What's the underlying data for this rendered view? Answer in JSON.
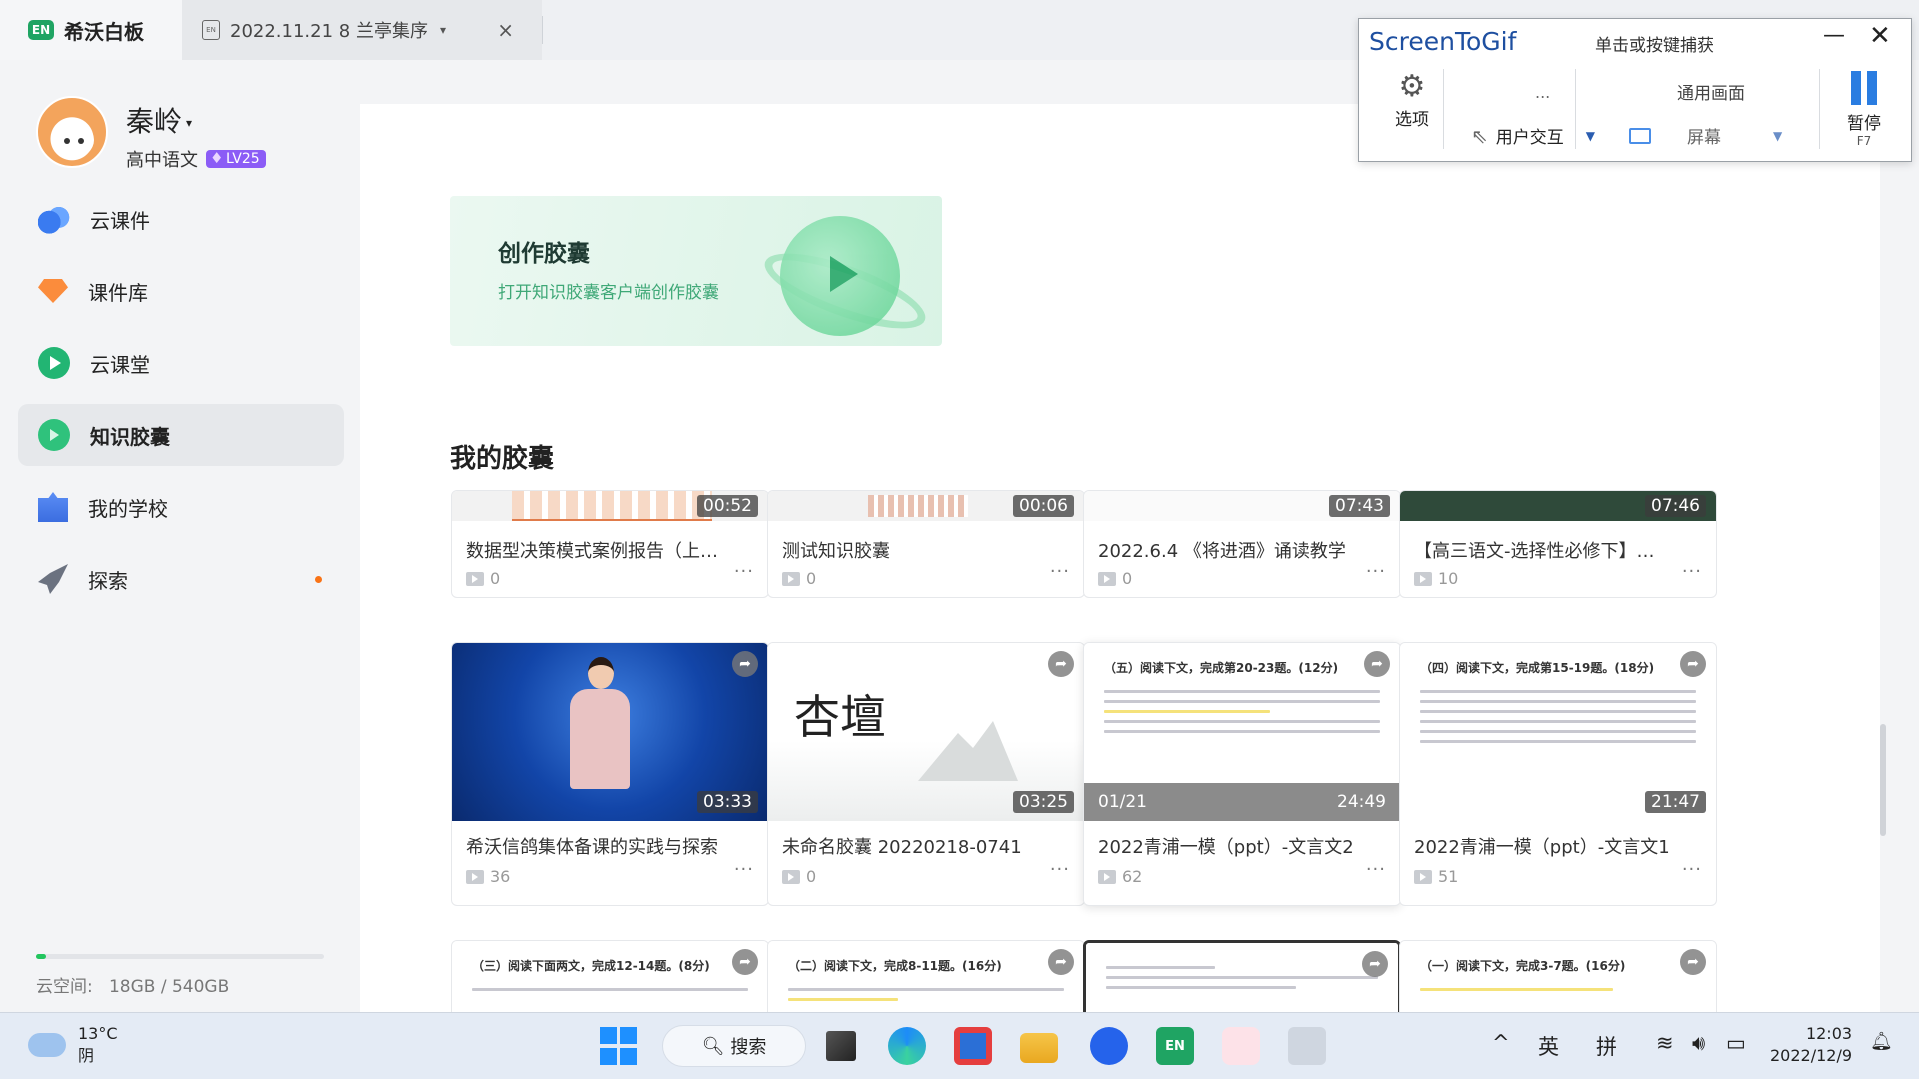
{
  "tabs": {
    "app_title": "希沃白板",
    "app_logo": "EN",
    "doc_tab_title": "2022.11.21 8 兰亭集序",
    "doc_tab_close": "×"
  },
  "user": {
    "name": "秦岭",
    "subject": "高中语文",
    "level": "LV25"
  },
  "nav": [
    {
      "label": "云课件",
      "icon": "cloud-icon"
    },
    {
      "label": "课件库",
      "icon": "gem-icon"
    },
    {
      "label": "云课堂",
      "icon": "play-icon"
    },
    {
      "label": "知识胶囊",
      "icon": "capsule-icon",
      "active": true
    },
    {
      "label": "我的学校",
      "icon": "school-icon"
    },
    {
      "label": "探索",
      "icon": "rocket-icon",
      "notification": true
    }
  ],
  "storage": {
    "label": "云空间:",
    "value": "18GB / 540GB",
    "fraction": 0.033
  },
  "banner": {
    "title": "创作胶囊",
    "subtitle": "打开知识胶囊客户端创作胶囊"
  },
  "section_title": "我的胶囊",
  "cards_row1": [
    {
      "title": "数据型决策模式案例报告（上…",
      "views": "0",
      "duration": "00:52"
    },
    {
      "title": "测试知识胶囊",
      "views": "0",
      "duration": "00:06"
    },
    {
      "title": "2022.6.4 《将进酒》诵读教学",
      "views": "0",
      "duration": "07:43"
    },
    {
      "title": "【高三语文-选择性必修下】…",
      "views": "10",
      "duration": "07:46"
    }
  ],
  "cards_row2": [
    {
      "title": "希沃信鸽集体备课的实践与探索",
      "views": "36",
      "duration": "03:33"
    },
    {
      "title": "未命名胶囊 20220218-0741",
      "views": "0",
      "duration": "03:25",
      "thumb_text": "杏壇"
    },
    {
      "title": "2022青浦一模（ppt）-文言文2",
      "views": "62",
      "duration": "24:49",
      "page": "01/21",
      "doc_heading": "（五）阅读下文，完成第20-23题。(12分)"
    },
    {
      "title": "2022青浦一模（ppt）-文言文1",
      "views": "51",
      "duration": "21:47",
      "doc_heading": "（四）阅读下文，完成第15-19题。(18分)"
    }
  ],
  "cards_row3": [
    {
      "doc_heading": "（三）阅读下面两文，完成12-14题。(8分)"
    },
    {
      "doc_heading": "（二）阅读下文，完成8-11题。(16分)"
    },
    {
      "doc_heading": ""
    },
    {
      "doc_heading": "（一）阅读下文，完成3-7题。(16分)"
    }
  ],
  "more_label": "···",
  "screentogif": {
    "brand": "ScreenToGif",
    "hint": "单击或按键捕获",
    "options": "选项",
    "dots": "...",
    "mode": "用户交互",
    "screen_label": "通用画面",
    "screen": "屏幕",
    "pause": "暂停",
    "pause_key": "F7",
    "minimize": "—",
    "close": "✕"
  },
  "taskbar": {
    "temp": "13°C",
    "weather": "阴",
    "search": "搜索",
    "ime_lang": "英",
    "ime_mode": "拼",
    "time": "12:03",
    "date": "2022/12/9"
  },
  "colors": {
    "accent_green": "#1fa463",
    "level_purple": "#8b5cf6",
    "notify_orange": "#f97316",
    "stg_blue": "#2a7de1"
  }
}
